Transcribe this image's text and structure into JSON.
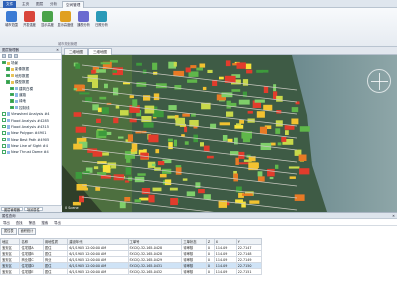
{
  "menu": {
    "file": "文件",
    "tabs": [
      "主页",
      "图层",
      "分析",
      "空间管理"
    ],
    "active_tab": "空间管理"
  },
  "ribbon": {
    "buttons": [
      {
        "label": "城市范围",
        "color": "#3b7bd4"
      },
      {
        "label": "开发强度",
        "color": "#d9463b"
      },
      {
        "label": "显示高度",
        "color": "#4aa34a"
      },
      {
        "label": "显示高度值",
        "color": "#e0a020"
      },
      {
        "label": "通视分析",
        "color": "#6a6ad0"
      },
      {
        "label": "日照分析",
        "color": "#2a9ab8"
      }
    ],
    "group_label": "城市规划管理"
  },
  "left_panel": {
    "title": "图层管理器",
    "close": "✕",
    "tree": [
      {
        "label": "场景",
        "level": 0,
        "kind": "folder",
        "checked": true
      },
      {
        "label": "影像数据",
        "level": 1,
        "kind": "folder",
        "checked": true
      },
      {
        "label": "地形数据",
        "level": 1,
        "kind": "folder",
        "checked": true
      },
      {
        "label": "模型数据",
        "level": 1,
        "kind": "folder",
        "checked": true
      },
      {
        "label": "建筑白模",
        "level": 2,
        "kind": "layer",
        "checked": true
      },
      {
        "label": "道路",
        "level": 2,
        "kind": "layer",
        "checked": true
      },
      {
        "label": "绿地",
        "level": 2,
        "kind": "layer",
        "checked": true
      },
      {
        "label": "控制线",
        "level": 2,
        "kind": "layer",
        "checked": true
      },
      {
        "label": "Viewshed Analysis #4",
        "level": 0,
        "kind": "layer",
        "checked": false
      },
      {
        "label": "Flood Analysis #4285",
        "level": 0,
        "kind": "layer",
        "checked": false
      },
      {
        "label": "Flood Analysis #4315",
        "level": 0,
        "kind": "layer",
        "checked": false
      },
      {
        "label": "New Polygon #4901",
        "level": 0,
        "kind": "layer",
        "checked": false
      },
      {
        "label": "New Best Path #4905",
        "level": 0,
        "kind": "layer",
        "checked": false
      },
      {
        "label": "New Line of Sight #4",
        "level": 0,
        "kind": "layer",
        "checked": false
      },
      {
        "label": "New Thrust Dome #4",
        "level": 0,
        "kind": "layer",
        "checked": false
      }
    ],
    "bottom_tabs": [
      "图层管理器",
      "场景属性"
    ]
  },
  "map": {
    "tabs": [
      "二维地图",
      "三维地图"
    ],
    "active_tab": "三维地图",
    "scale": "0 Scene"
  },
  "bottom_panel": {
    "title": "属性查询",
    "close": "✕",
    "toolbar": [
      "导出",
      "查找",
      "筛选",
      "搜索",
      "导出"
    ],
    "tabs": [
      "属性表",
      "面积统计"
    ],
    "columns": [
      "地区",
      "名称",
      "用地性质",
      "建设年代",
      "工单号",
      "工单状态",
      "Z",
      "X",
      "Y"
    ],
    "rows": [
      [
        "宝安区",
        "住宅楼A",
        "居住",
        "6/1/1905 12:00:00 AM",
        "SY-DQ-32-165-0428",
        "待审核",
        "0",
        "114.09",
        "22.7147"
      ],
      [
        "宝安区",
        "住宅楼B",
        "居住",
        "6/1/1905 12:00:00 AM",
        "SY-DQ-32-165-0428",
        "待审核",
        "0",
        "114.09",
        "22.7148"
      ],
      [
        "宝安区",
        "商业楼C",
        "商业",
        "6/1/1905 12:00:00 AM",
        "SY-DQ-32-165-0429",
        "待审核",
        "0",
        "114.09",
        "22.7149"
      ],
      [
        "宝安区",
        "住宅楼D",
        "居住",
        "6/1/1905 12:00:00 AM",
        "SY-DQ-32-165-0431",
        "待审核",
        "0",
        "114.09",
        "22.7150"
      ],
      [
        "宝安区",
        "住宅楼E",
        "居住",
        "6/1/1905 12:00:00 AM",
        "SY-DQ-32-165-0432",
        "待审核",
        "0",
        "114.09",
        "22.7151"
      ]
    ]
  }
}
